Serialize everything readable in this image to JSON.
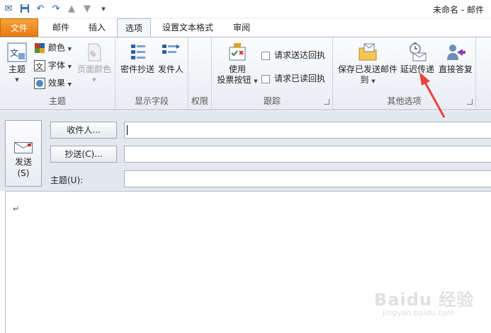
{
  "window": {
    "title": "未命名 - 邮件"
  },
  "tabs": [
    "文件",
    "邮件",
    "插入",
    "选项",
    "设置文本格式",
    "审阅"
  ],
  "ribbon": {
    "theme_group": {
      "label": "主题",
      "theme": "主题",
      "colors": "颜色",
      "fonts": "字体",
      "effects": "效果",
      "page_color": "页面颜色"
    },
    "fields_group": {
      "label": "显示字段",
      "bcc": "密件抄送",
      "from": "发件人"
    },
    "permission_group": {
      "label": "权限"
    },
    "tracking_group": {
      "label": "跟踪",
      "use_line1": "使用",
      "use_line2": "投票按钮",
      "request_delivery": "请求送达回执",
      "request_read": "请求已读回执"
    },
    "more_group": {
      "label": "其他选项",
      "save_sent_line1": "保存已发送邮件",
      "save_sent_line2": "到",
      "delay": "延迟传递",
      "direct_replies": "直接答复"
    }
  },
  "compose": {
    "send_line1": "发送",
    "send_line2": "(S)",
    "to_button": "收件人...",
    "cc_button": "抄送(C)...",
    "subject_label": "主题(U):",
    "to_value": "",
    "cc_value": "",
    "subject_value": "",
    "body_mark": "↵"
  },
  "colors": {
    "file_tab": "#e57c12",
    "annotation_arrow": "#e8443a"
  },
  "watermark": {
    "main": "Baidu 经验",
    "sub": "jingyan.baidu.com"
  }
}
